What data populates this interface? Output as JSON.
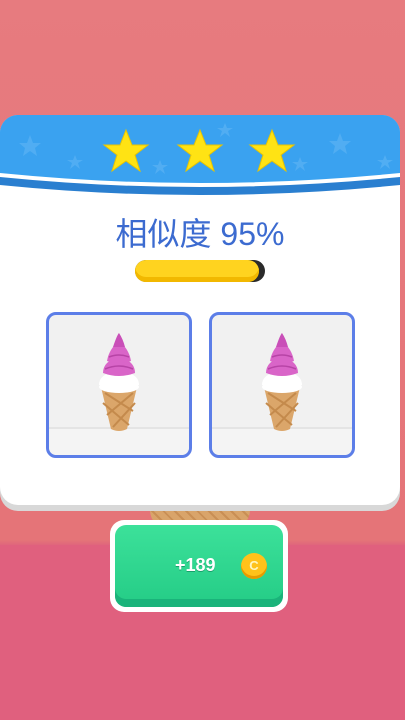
{
  "result": {
    "stars_earned": 3,
    "stars_total": 3,
    "star_color": "#ffe314",
    "similarity_label": "相似度",
    "similarity_value": "95%",
    "similarity_fraction": 0.95
  },
  "comparison": {
    "target_card": {
      "icon": "ice-cream-cone-icon",
      "swirl_color": "#d965c8"
    },
    "result_card": {
      "icon": "ice-cream-cone-icon",
      "swirl_color": "#d965c8"
    }
  },
  "reward": {
    "amount": "+189",
    "coin_glyph": "C",
    "button_color": "#2fd48e"
  },
  "colors": {
    "background": "#e57478",
    "banner": "#3aa2f0",
    "title_text": "#3c6bd0",
    "card_border": "#5c7ee8",
    "progress_fill": "#ffd31f"
  }
}
